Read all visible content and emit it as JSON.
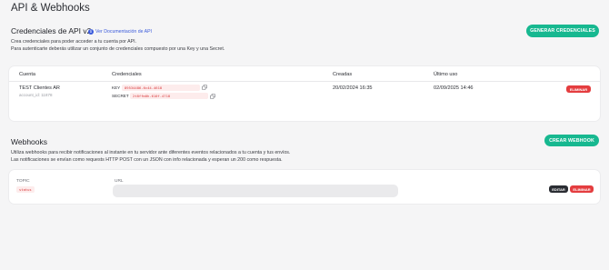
{
  "page": {
    "title": "API & Webhooks"
  },
  "api_section": {
    "title": "Credenciales de API v2",
    "doc_link": "Ver Documentación de API",
    "info_icon": "info-icon",
    "description_1": "Crea credenciales para poder acceder a tu cuenta por API.",
    "description_2": "Para autenticarte deberás utilizar un conjunto de credenciales compuesto por una Key y una Secret.",
    "generate_button": "GENERAR CREDENCIALES",
    "table": {
      "headers": {
        "account": "Cuenta",
        "credentials": "Credenciales",
        "created": "Creadas",
        "last_use": "Último uso"
      },
      "rows": [
        {
          "account_name": "TEST Clientes AR",
          "account_id": "account_id: 11878",
          "key_label": "KEY",
          "key_value": "89534486-6c44-4618",
          "secret_label": "SECRET",
          "secret_value": "2t8ffm0h-610f-4718",
          "created": "20/02/2024 16:35",
          "last_use": "02/09/2025 14:46",
          "delete_button": "ELIMINAR"
        }
      ]
    }
  },
  "webhooks_section": {
    "title": "Webhooks",
    "description_1": "Utiliza webhooks para recibir notificaciones al instante en tu servidor ante diferentes eventos relacionados a tu cuenta y tus envíos.",
    "description_2": "Las notificaciones se envían como requests HTTP POST con un JSON con info relacionada y esperan un 200 como respuesta.",
    "create_button": "CREAR WEBHOOK",
    "item": {
      "topic_label": "TOPIC",
      "topic_value": "status",
      "url_label": "URL",
      "url_value": "",
      "edit_button": "EDITAR",
      "delete_button": "ELIMINAR"
    }
  },
  "colors": {
    "accent": "#17b890",
    "danger": "#e43d3f",
    "link": "#3b5bdb",
    "dark": "#2a2d33"
  }
}
